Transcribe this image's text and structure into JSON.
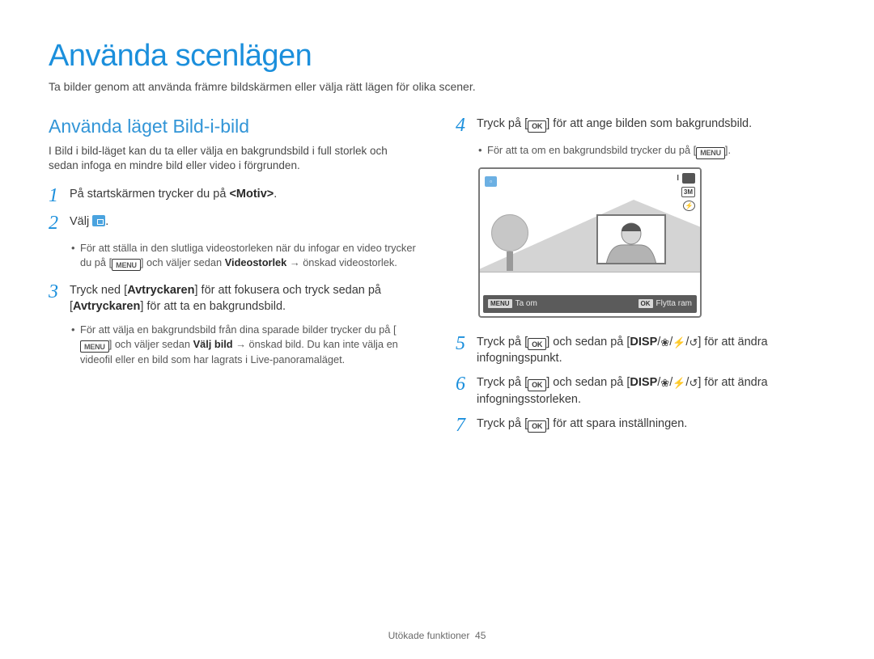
{
  "title": "Använda scenlägen",
  "intro": "Ta bilder genom att använda främre bildskärmen eller välja rätt lägen för olika scener.",
  "section": {
    "title": "Använda läget Bild-i-bild",
    "intro": "I Bild i bild-läget kan du ta eller välja en bakgrundsbild i full storlek och sedan infoga en mindre bild eller video i förgrunden."
  },
  "labels": {
    "OK": "OK",
    "MENU": "MENU",
    "DISP": "DISP"
  },
  "steps": [
    {
      "num": "1",
      "text_before": "På startskärmen trycker du på ",
      "motiv": "<Motiv>",
      "text_after": "."
    },
    {
      "num": "2",
      "text": "Välj ",
      "bullet_a": "För att ställa in den slutliga videostorleken när du infogar en video trycker du på [",
      "bullet_b": "] och väljer sedan ",
      "videostorlek": "Videostorlek",
      "bullet_c": " → önskad videostorlek."
    },
    {
      "num": "3",
      "p1_a": "Tryck ned [",
      "avtryckaren": "Avtryckaren",
      "p1_b": "] för att fokusera och tryck sedan på [",
      "p1_c": "] för att ta en bakgrundsbild.",
      "bul_a": "För att välja en bakgrundsbild från dina sparade bilder trycker du på [",
      "bul_b": "] och väljer sedan ",
      "valj_bild": "Välj bild",
      "bul_c": " → önskad bild. Du kan inte välja en videofil eller en bild som har lagrats i Live-panoramaläget."
    },
    {
      "num": "4",
      "text_a": "Tryck på [",
      "text_b": "] för att ange bilden som bakgrundsbild.",
      "bul_a": "För att ta om en bakgrundsbild trycker du på [",
      "bul_b": "]."
    },
    {
      "num": "5",
      "text_a": "Tryck på [",
      "text_b": "] och sedan på [",
      "text_c": "] för att ändra infogningspunkt."
    },
    {
      "num": "6",
      "text_a": "Tryck på [",
      "text_b": "] och sedan på [",
      "text_c": "] för att ändra infogningsstorleken."
    },
    {
      "num": "7",
      "text_a": "Tryck på [",
      "text_b": "] för att spara inställningen."
    }
  ],
  "screen": {
    "bar_left_label": "Ta om",
    "bar_right_label": "Flytta ram"
  },
  "footer": {
    "section": "Utökade funktioner",
    "page": "45"
  }
}
